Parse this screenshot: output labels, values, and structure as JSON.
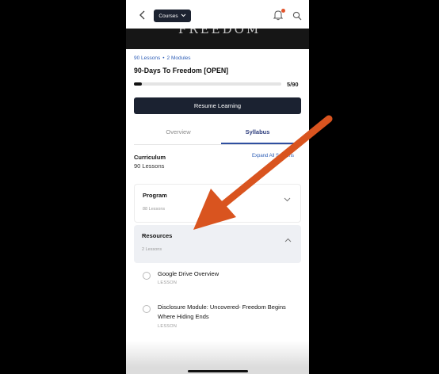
{
  "topbar": {
    "back_icon": "chevron-left-icon",
    "courses_label": "Courses",
    "notification_icon": "bell-icon",
    "search_icon": "search-icon"
  },
  "banner": {
    "text": "FREEDOM"
  },
  "course": {
    "lessons_count": "90 Lessons",
    "modules_count": "2 Modules",
    "title": "90-Days To Freedom [OPEN]",
    "progress_text": "5/90",
    "progress_value": 0.056
  },
  "resume_label": "Resume Learning",
  "tabs": [
    {
      "label": "Overview",
      "active": false
    },
    {
      "label": "Syllabus",
      "active": true
    }
  ],
  "curriculum": {
    "label": "Curriculum",
    "count": "90 Lessons",
    "expand_label": "Expand All Sections"
  },
  "modules": [
    {
      "title": "Program",
      "subtitle": "88 Lessons",
      "expanded": false
    },
    {
      "title": "Resources",
      "subtitle": "2 Lessons",
      "expanded": true
    }
  ],
  "lessons": [
    {
      "title": "Google Drive Overview",
      "type": "LESSON"
    },
    {
      "title": "Disclosure Module: Uncovered- Freedom Begins Where Hiding Ends",
      "type": "LESSON"
    }
  ],
  "colors": {
    "accent_dark": "#1b2231",
    "link_blue": "#2f5fb7",
    "annotation_arrow": "#d9541f",
    "notification_dot": "#e2542c"
  }
}
